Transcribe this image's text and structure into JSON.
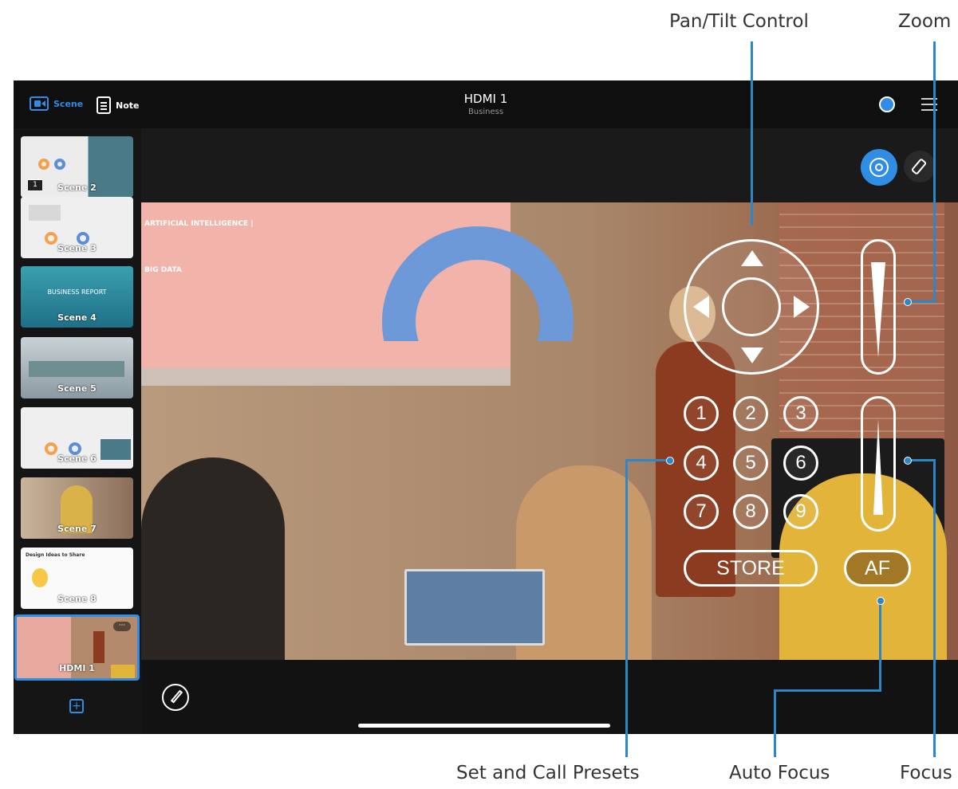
{
  "callouts": {
    "pan_tilt": "Pan/Tilt Control",
    "zoom": "Zoom",
    "set_call_presets": "Set and Call Presets",
    "auto_focus": "Auto Focus",
    "focus": "Focus"
  },
  "topbar": {
    "tab_scene": "Scene",
    "tab_note": "Note",
    "title": "HDMI 1",
    "subtitle": "Business"
  },
  "sidebar": {
    "items": [
      {
        "label": "Scene 2",
        "badge": "1"
      },
      {
        "label": "Scene 3"
      },
      {
        "label": "Scene 4",
        "heading": "BUSINESS REPORT"
      },
      {
        "label": "Scene 5"
      },
      {
        "label": "Scene 6"
      },
      {
        "label": "Scene 7"
      },
      {
        "label": "Scene 8",
        "heading": "Design Ideas to Share"
      },
      {
        "label": "HDMI 1",
        "selected": true,
        "more": "···"
      }
    ],
    "add_label": "+"
  },
  "video": {
    "proj_line1": "ARTIFICIAL INTELLIGENCE |",
    "proj_line2": "BIG DATA"
  },
  "controls": {
    "presets": [
      "1",
      "2",
      "3",
      "4",
      "5",
      "6",
      "7",
      "8",
      "9"
    ],
    "store_label": "STORE",
    "af_label": "AF"
  },
  "colors": {
    "accent": "#2f8de4",
    "leader": "#2c86c7"
  },
  "icons": [
    "camera-icon",
    "note-icon",
    "more-icon",
    "menu-icon",
    "ptz-icon",
    "remote-icon",
    "pencil-icon",
    "add-icon"
  ]
}
